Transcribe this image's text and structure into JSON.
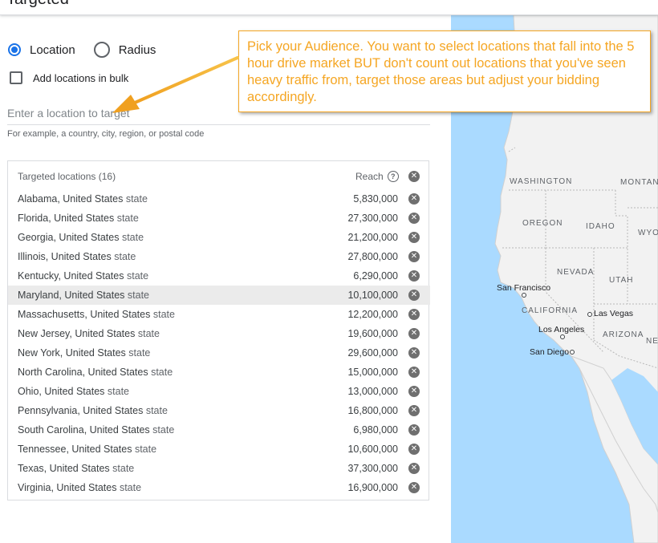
{
  "header": {
    "title": "Targeted"
  },
  "location_mode": {
    "options": [
      {
        "label": "Location",
        "checked": true
      },
      {
        "label": "Radius",
        "checked": false
      }
    ]
  },
  "bulk": {
    "label": "Add locations in bulk",
    "checked": false
  },
  "search": {
    "placeholder": "Enter a location to target",
    "hint": "For example, a country, city, region, or postal code"
  },
  "targeted": {
    "title": "Targeted locations (16)",
    "reach_label": "Reach",
    "rows": [
      {
        "name": "Alabama, United States",
        "type": "state",
        "reach": "5,830,000"
      },
      {
        "name": "Florida, United States",
        "type": "state",
        "reach": "27,300,000"
      },
      {
        "name": "Georgia, United States",
        "type": "state",
        "reach": "21,200,000"
      },
      {
        "name": "Illinois, United States",
        "type": "state",
        "reach": "27,800,000"
      },
      {
        "name": "Kentucky, United States",
        "type": "state",
        "reach": "6,290,000"
      },
      {
        "name": "Maryland, United States",
        "type": "state",
        "reach": "10,100,000"
      },
      {
        "name": "Massachusetts, United States",
        "type": "state",
        "reach": "12,200,000"
      },
      {
        "name": "New Jersey, United States",
        "type": "state",
        "reach": "19,600,000"
      },
      {
        "name": "New York, United States",
        "type": "state",
        "reach": "29,600,000"
      },
      {
        "name": "North Carolina, United States",
        "type": "state",
        "reach": "15,000,000"
      },
      {
        "name": "Ohio, United States",
        "type": "state",
        "reach": "13,000,000"
      },
      {
        "name": "Pennsylvania, United States",
        "type": "state",
        "reach": "16,800,000"
      },
      {
        "name": "South Carolina, United States",
        "type": "state",
        "reach": "6,980,000"
      },
      {
        "name": "Tennessee, United States",
        "type": "state",
        "reach": "10,600,000"
      },
      {
        "name": "Texas, United States",
        "type": "state",
        "reach": "37,300,000"
      },
      {
        "name": "Virginia, United States",
        "type": "state",
        "reach": "16,900,000"
      }
    ]
  },
  "map": {
    "states": [
      "WASHINGTON",
      "MONTAN",
      "OREGON",
      "IDAHO",
      "WYO",
      "NEVADA",
      "UTAH",
      "CALIFORNIA",
      "ARIZONA",
      "NE"
    ],
    "cities": [
      "San Francisco",
      "Las Vegas",
      "Los Angeles",
      "San Diego"
    ]
  },
  "callout": {
    "text": "Pick your Audience. You want to select locations that fall into the 5 hour drive market BUT don't count out locations that you've seen heavy traffic from, target those areas but adjust your bidding accordingly."
  },
  "colors": {
    "accent": "#1a73e8",
    "callout": "#f5a623",
    "water": "#aadaff",
    "land": "#f2f2f2",
    "highlight_row": "#ebebeb"
  }
}
